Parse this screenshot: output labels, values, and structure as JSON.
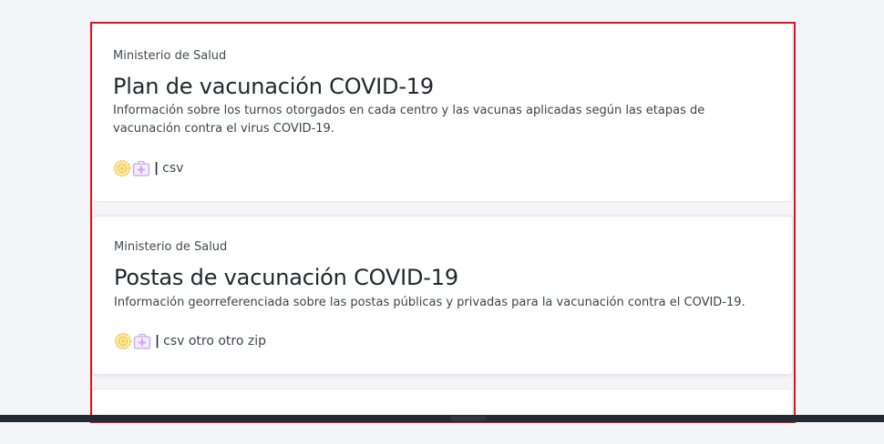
{
  "datasets": [
    {
      "publisher": "Ministerio de Salud",
      "title": "Plan de vacunación COVID-19",
      "description": "Información sobre los turnos otorgados en cada centro y las vacunas aplicadas según las etapas de vacunación contra el virus COVID-19.",
      "separator": "|",
      "formats": "csv",
      "icons": [
        "gear-badge-icon",
        "medical-case-icon"
      ]
    },
    {
      "publisher": "Ministerio de Salud",
      "title": "Postas de vacunación COVID-19",
      "description": "Información georreferenciada sobre las postas públicas y privadas para la vacunación contra el COVID-19.",
      "separator": "|",
      "formats": "csv otro otro zip",
      "icons": [
        "gear-badge-icon",
        "medical-case-icon"
      ]
    }
  ],
  "colors": {
    "page_background": "#f3f5f8",
    "card_background": "#ffffff",
    "highlight_border": "#e0141c",
    "gear_icon": "#f2c94c",
    "case_icon": "#c9a6e8",
    "footer_bar": "#232a33"
  }
}
